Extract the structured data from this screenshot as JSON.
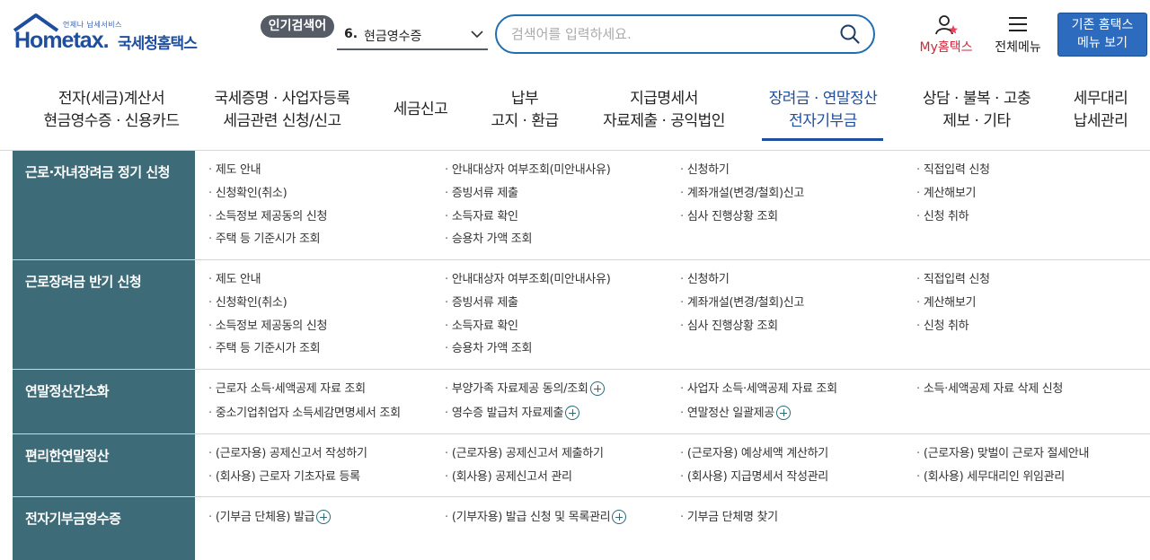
{
  "header": {
    "logo_sub": "언제나 납세서비스",
    "logo_home": "Home",
    "logo_tax": "tax.",
    "logo_kor": "국세청홈택스",
    "popular_label": "인기검색어",
    "popular_rank": "6.",
    "popular_term": "현금영수증",
    "search_placeholder": "검색어를 입력하세요.",
    "my_label": "My홈택스",
    "all_menu_label": "전체메뉴",
    "old_line1": "기존 홈택스",
    "old_line2": "메뉴 보기"
  },
  "gnb": [
    {
      "l1": "전자(세금)계산서",
      "l2": "현금영수증 · 신용카드"
    },
    {
      "l1": "국세증명 · 사업자등록",
      "l2": "세금관련 신청/신고"
    },
    {
      "l1": "세금신고",
      "l2": ""
    },
    {
      "l1": "납부",
      "l2": "고지 · 환급"
    },
    {
      "l1": "지급명세서",
      "l2": "자료제출 · 공익법인"
    },
    {
      "l1": "장려금 · 연말정산",
      "l2": "전자기부금"
    },
    {
      "l1": "상담 · 불복 · 고충",
      "l2": "제보 · 기타"
    },
    {
      "l1": "세무대리",
      "l2": "납세관리"
    }
  ],
  "menu": [
    {
      "title": "근로·자녀장려금 정기 신청",
      "cols": [
        [
          "제도 안내",
          "신청확인(취소)",
          "소득정보 제공동의 신청",
          "주택 등 기준시가 조회"
        ],
        [
          "안내대상자 여부조회(미안내사유)",
          "증빙서류 제출",
          "소득자료 확인",
          "승용차 가액 조회"
        ],
        [
          "신청하기",
          "계좌개설(변경/철회)신고",
          "심사 진행상황 조회"
        ],
        [
          "직접입력 신청",
          "계산해보기",
          "신청 취하"
        ]
      ]
    },
    {
      "title": "근로장려금 반기 신청",
      "cols": [
        [
          "제도 안내",
          "신청확인(취소)",
          "소득정보 제공동의 신청",
          "주택 등 기준시가 조회"
        ],
        [
          "안내대상자 여부조회(미안내사유)",
          "증빙서류 제출",
          "소득자료 확인",
          "승용차 가액 조회"
        ],
        [
          "신청하기",
          "계좌개설(변경/철회)신고",
          "심사 진행상황 조회"
        ],
        [
          "직접입력 신청",
          "계산해보기",
          "신청 취하"
        ]
      ]
    },
    {
      "title": "연말정산간소화",
      "cols": [
        [
          "근로자 소득·세액공제 자료 조회",
          "중소기업취업자 소득세감면명세서 조회"
        ],
        [
          "부양가족 자료제공 동의/조회",
          "영수증 발급처 자료제출"
        ],
        [
          "사업자 소득·세액공제 자료 조회",
          "연말정산 일괄제공"
        ],
        [
          "소득·세액공제 자료 삭제 신청"
        ]
      ]
    },
    {
      "title": "편리한연말정산",
      "cols": [
        [
          "(근로자용) 공제신고서 작성하기",
          "(회사용) 근로자 기초자료 등록"
        ],
        [
          "(근로자용) 공제신고서 제출하기",
          "(회사용) 공제신고서 관리"
        ],
        [
          "(근로자용) 예상세액 계산하기",
          "(회사용) 지급명세서 작성관리"
        ],
        [
          "(근로자용) 맞벌이 근로자 절세안내",
          "(회사용) 세무대리인 위임관리"
        ]
      ]
    },
    {
      "title": "전자기부금영수증",
      "cols": [
        [
          "(기부금 단체용) 발급"
        ],
        [
          "(기부자용) 발급 신청 및 목록관리"
        ],
        [
          "기부금 단체명 찾기"
        ],
        []
      ]
    }
  ]
}
